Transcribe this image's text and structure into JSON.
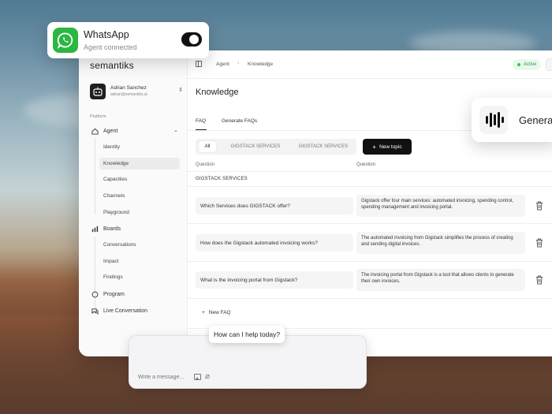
{
  "whatsapp": {
    "title": "WhatsApp",
    "status": "Agent connected",
    "enabled": true,
    "brand_color": "#2BB741"
  },
  "sidebar": {
    "brand": "semantiks",
    "user": {
      "name": "Adrian Sanchez",
      "email": "adrian@semantiks.ai"
    },
    "section_label": "Platform",
    "agent": {
      "label": "Agent",
      "children": [
        "Identity",
        "Knowledge",
        "Capacities",
        "Channels",
        "Playground"
      ]
    },
    "boards": {
      "label": "Boards",
      "children": [
        "Conversations",
        "Impact",
        "Findings"
      ]
    },
    "program": "Program",
    "live": "Live Conversation"
  },
  "topbar": {
    "crumbs": [
      "Agent",
      "Knowledge"
    ],
    "status": "Active",
    "status_color": "#34C759"
  },
  "page": {
    "title": "Knowledge",
    "tabs": [
      "FAQ",
      "Generate FAQs"
    ],
    "filters": [
      "All",
      "GIGSTACK SERVICES",
      "GIGSTACK SERVICES"
    ],
    "new_topic": "New topic",
    "columns": [
      "Question",
      "Question"
    ],
    "group": "GIGSTACK SERVICES",
    "faqs": [
      {
        "q": "Which Services does GIGSTACK offer?",
        "a": "Gigstack offer four main services: automated invoicing, spending control, spending management and invoicing portal."
      },
      {
        "q": "How does the Gigstack automated invoicing works?",
        "a": "The automated invoicing from Gigstack simplifies the process of creating and sending digital invoices."
      },
      {
        "q": "What is the invoicing portal from Gigstack?",
        "a": "The invoicing portal from Gigstack is a tool that allows clients to generate their own invoices."
      }
    ],
    "new_faq": "New FAQ"
  },
  "generate_card": {
    "label": "Genera"
  },
  "chat": {
    "bubble": "How can I help today?",
    "placeholder": "Write a message..."
  }
}
